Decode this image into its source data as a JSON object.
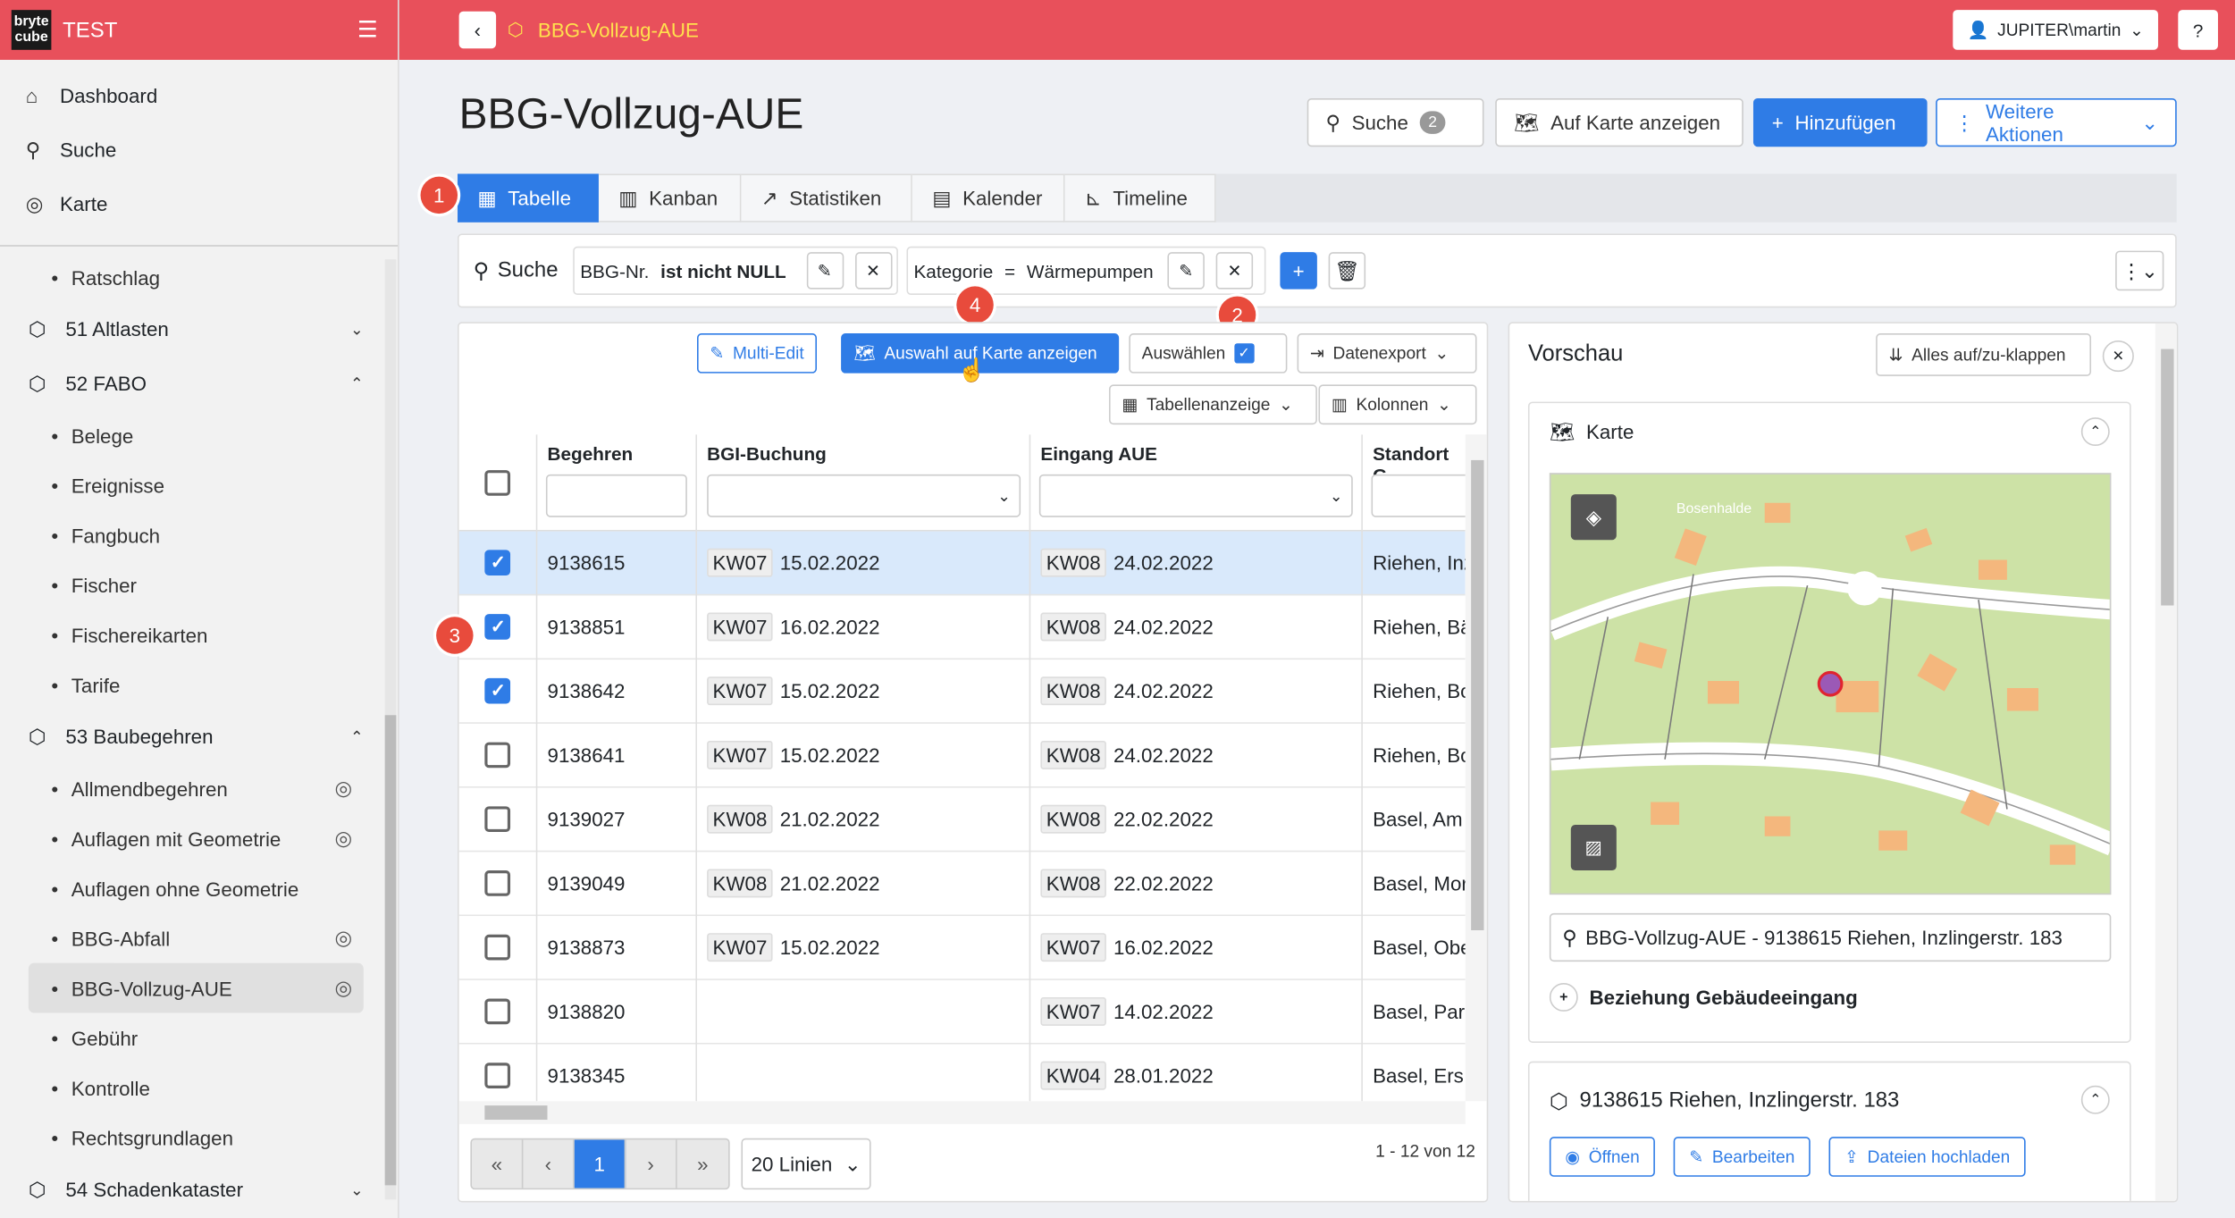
{
  "app": {
    "name": "TEST",
    "logo_top": "bryte",
    "logo_bottom": "cube"
  },
  "sidebar": {
    "top_items": [
      {
        "label": "Dashboard",
        "icon": "home-icon"
      },
      {
        "label": "Suche",
        "icon": "search-icon"
      },
      {
        "label": "Karte",
        "icon": "globe-icon"
      }
    ],
    "ratschlag": "Ratschlag",
    "sections": {
      "s51": "51 Altlasten",
      "s52": "52 FABO",
      "s53": "53 Baubegehren",
      "s54": "54 Schadenkataster"
    },
    "fabo_items": [
      "Belege",
      "Ereignisse",
      "Fangbuch",
      "Fischer",
      "Fischereikarten",
      "Tarife"
    ],
    "bau_items": [
      "Allmendbegehren",
      "Auflagen mit Geometrie",
      "Auflagen ohne Geometrie",
      "BBG-Abfall",
      "BBG-Vollzug-AUE",
      "Gebühr",
      "Kontrolle",
      "Rechtsgrundlagen"
    ]
  },
  "header": {
    "title": "BBG-Vollzug-AUE",
    "user": "JUPITER\\martin",
    "help": "?"
  },
  "page": {
    "title": "BBG-Vollzug-AUE",
    "search_btn": "Suche",
    "search_count": "2",
    "map_btn": "Auf Karte anzeigen",
    "add_btn": "Hinzufügen",
    "more_btn": "Weitere Aktionen"
  },
  "tabs": [
    "Tabelle",
    "Kanban",
    "Statistiken",
    "Kalender",
    "Timeline"
  ],
  "filter": {
    "label": "Suche",
    "chip1_field": "BBG-Nr.",
    "chip1_cond": "ist nicht NULL",
    "chip2_field": "Kategorie",
    "chip2_op": "=",
    "chip2_value": "Wärmepumpen"
  },
  "markers": [
    "1",
    "2",
    "3",
    "4"
  ],
  "toolbar": {
    "multiedit": "Multi-Edit",
    "show_on_map": "Auswahl auf Karte anzeigen",
    "select": "Auswählen",
    "export": "Datenexport",
    "table_view": "Tabellenanzeige",
    "columns": "Kolonnen"
  },
  "table": {
    "headers": [
      "Begehren",
      "BGI-Buchung",
      "Eingang AUE",
      "Standort G"
    ],
    "rows": [
      {
        "checked": true,
        "begehren": "9138615",
        "bgi_kw": "KW07",
        "bgi_date": "15.02.2022",
        "eing_kw": "KW08",
        "eing_date": "24.02.2022",
        "standort": "Riehen, Inz"
      },
      {
        "checked": true,
        "begehren": "9138851",
        "bgi_kw": "KW07",
        "bgi_date": "16.02.2022",
        "eing_kw": "KW08",
        "eing_date": "24.02.2022",
        "standort": "Riehen, Bä"
      },
      {
        "checked": true,
        "begehren": "9138642",
        "bgi_kw": "KW07",
        "bgi_date": "15.02.2022",
        "eing_kw": "KW08",
        "eing_date": "24.02.2022",
        "standort": "Riehen, Bo"
      },
      {
        "checked": false,
        "begehren": "9138641",
        "bgi_kw": "KW07",
        "bgi_date": "15.02.2022",
        "eing_kw": "KW08",
        "eing_date": "24.02.2022",
        "standort": "Riehen, Bo"
      },
      {
        "checked": false,
        "begehren": "9139027",
        "bgi_kw": "KW08",
        "bgi_date": "21.02.2022",
        "eing_kw": "KW08",
        "eing_date": "22.02.2022",
        "standort": "Basel, Am"
      },
      {
        "checked": false,
        "begehren": "9139049",
        "bgi_kw": "KW08",
        "bgi_date": "21.02.2022",
        "eing_kw": "KW08",
        "eing_date": "22.02.2022",
        "standort": "Basel, Mor"
      },
      {
        "checked": false,
        "begehren": "9138873",
        "bgi_kw": "KW07",
        "bgi_date": "15.02.2022",
        "eing_kw": "KW07",
        "eing_date": "16.02.2022",
        "standort": "Basel, Obe"
      },
      {
        "checked": false,
        "begehren": "9138820",
        "bgi_kw": "",
        "bgi_date": "",
        "eing_kw": "KW07",
        "eing_date": "14.02.2022",
        "standort": "Basel, Par"
      },
      {
        "checked": false,
        "begehren": "9138345",
        "bgi_kw": "",
        "bgi_date": "",
        "eing_kw": "KW04",
        "eing_date": "28.01.2022",
        "standort": "Basel, Ers"
      }
    ]
  },
  "pager": {
    "current": "1",
    "per_page": "20 Linien",
    "count": "1 - 12 von 12"
  },
  "preview": {
    "title": "Vorschau",
    "collapse_btn": "Alles auf/zu-klappen",
    "map_card_title": "Karte",
    "map_place": "Bosenhalde",
    "location": "BBG-Vollzug-AUE - 9138615 Riehen, Inzlingerstr. 183",
    "relation": "Beziehung Gebäudeeingang",
    "record_title": "9138615 Riehen, Inzlingerstr. 183",
    "open_btn": "Öffnen",
    "edit_btn": "Bearbeiten",
    "upload_btn": "Dateien hochladen"
  },
  "colors": {
    "header_bg": "#e8505b",
    "accent": "#2f7ce6",
    "marker": "#e84b3c",
    "header_title": "#ffe14d"
  }
}
